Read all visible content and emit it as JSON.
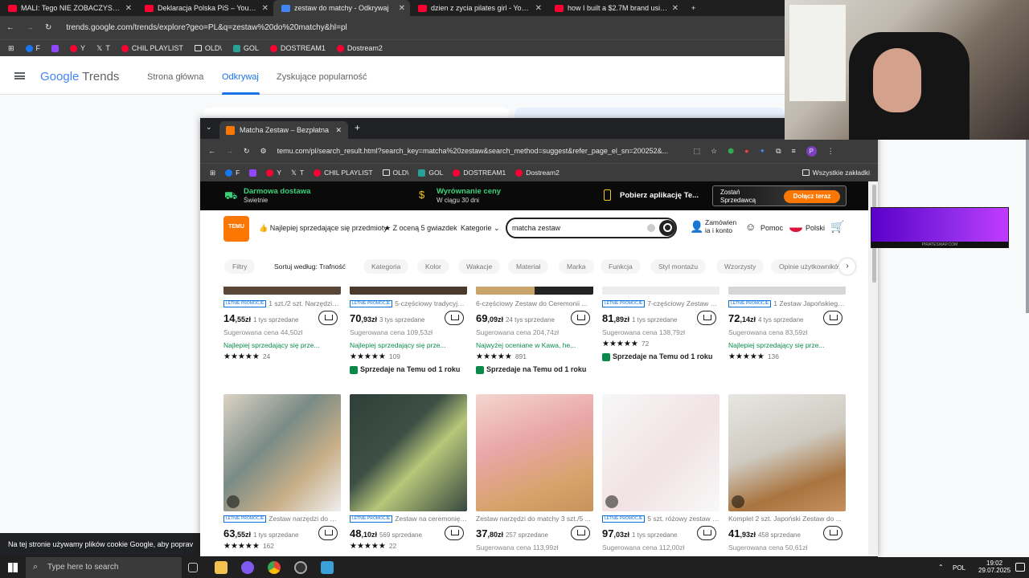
{
  "outer_tabs": [
    {
      "label": "MALI: Tego NIE ZOBACZYSZ w"
    },
    {
      "label": "Deklaracja Polska PiS – YouTube"
    },
    {
      "label": "zestaw do matchy - Odkrywaj"
    },
    {
      "label": "dzien z zycia pilates girl - YouTu"
    },
    {
      "label": "how I built a $2.7M brand using"
    }
  ],
  "outer_url": "trends.google.com/trends/explore?geo=PL&q=zestaw%20do%20matchy&hl=pl",
  "bookmarks": [
    "F",
    "Y",
    "T",
    "CHIL PLAYLIST",
    "OLD\\",
    "GOL",
    "DOSTREAM1",
    "Dostream2"
  ],
  "trends": {
    "logo_google": "Google",
    "logo_trends": "Trends",
    "nav": [
      "Strona główna",
      "Odkrywaj",
      "Zyskujące popularność"
    ],
    "cookie_text": "Na tej stronie używamy plików cookie Google, aby poprav"
  },
  "inner": {
    "tab_title": "Matcha Zestaw – Bezpłatna wy",
    "url": "temu.com/pl/search_result.html?search_key=matcha%20zestaw&search_method=suggest&refer_page_el_sn=200252&...",
    "bookmarks_right": "Wszystkie zakładki"
  },
  "promo": {
    "free_delivery": "Darmowa dostawa",
    "free_delivery_sub": "Świetnie",
    "price_adjust": "Wyrównanie ceny",
    "price_adjust_sub": "W ciągu 30 dni",
    "app": "Pobierz aplikację Te...",
    "seller_line1": "Zostań",
    "seller_line2": "Sprzedawcą",
    "join": "Dołącz teraz"
  },
  "temu_header": {
    "logo": "TEMU",
    "best_sellers": "Najlepiej sprzedające się przedmioty",
    "five_star": "Z oceną 5 gwiazdek",
    "categories": "Kategorie",
    "search_value": "matcha zestaw",
    "orders_line1": "Zamówien",
    "orders_line2": "ia i konto",
    "help": "Pomoc",
    "language": "Polski"
  },
  "filters": [
    "Filtry",
    "Sortuj według: Trafność",
    "Kategoria",
    "Kolor",
    "Wakacje",
    "Materiał",
    "Marka",
    "Funkcja",
    "Styl montażu",
    "Wzorzysty",
    "Opinie użytkowników"
  ],
  "badge_text": "LETNIE PROMOCJE",
  "row1": [
    {
      "title": "1 szt./2 szt. Narzędzia do ...",
      "price_int": "14",
      "price_dec": ",55zł",
      "sold": "1 tys sprzedane",
      "suggested": "Sugerowana cena 44,50zł",
      "tag": "Najlepiej sprzedający się prze...",
      "stars": "★★★★★",
      "reviews": "24",
      "since": ""
    },
    {
      "title": "5-częściowy tradycyjny jap...",
      "price_int": "70",
      "price_dec": ",93zł",
      "sold": "3 tys sprzedane",
      "suggested": "Sugerowana cena 109,53zł",
      "tag": "Najlepiej sprzedający się prze...",
      "stars": "★★★★★",
      "reviews": "109",
      "since": "Sprzedaje na Temu od 1 roku"
    },
    {
      "title": "6-częściowy Zestaw do Ceremonii ...",
      "price_int": "69",
      "price_dec": ",09zł",
      "sold": "24 tys sprzedane",
      "suggested": "Sugerowana cena 204,74zł",
      "tag": "Najwyżej oceniane w Kawa, he...",
      "stars": "★★★★★",
      "reviews": "891",
      "since": "Sprzedaje na Temu od 1 roku"
    },
    {
      "title": "7-częściowy Zestaw Do Ce...",
      "price_int": "81",
      "price_dec": ",89zł",
      "sold": "1 tys sprzedane",
      "suggested": "Sugerowana cena 138,79zł",
      "tag": "",
      "stars": "★★★★★",
      "reviews": "72",
      "since": "Sprzedaje na Temu od 1 roku"
    },
    {
      "title": "1 Zestaw Japońskiego Cera...",
      "price_int": "72",
      "price_dec": ",14zł",
      "sold": "4 tys sprzedane",
      "suggested": "Sugerowana cena 83,59zł",
      "tag": "Najlepiej sprzedający się prze...",
      "stars": "★★★★★",
      "reviews": "136",
      "since": ""
    }
  ],
  "row2": [
    {
      "title": "Zestaw narzędzi do match...",
      "price_int": "63",
      "price_dec": ",55zł",
      "sold": "1 tys sprzedane",
      "suggested": "",
      "stars": "★★★★★",
      "reviews": "162"
    },
    {
      "title": "Zestaw na ceremonię herb...",
      "price_int": "48",
      "price_dec": ",10zł",
      "sold": "569 sprzedane",
      "suggested": "",
      "stars": "★★★★★",
      "reviews": "22"
    },
    {
      "title": "Zestaw narzędzi do matchy 3 szt./5 ...",
      "price_int": "37",
      "price_dec": ",80zł",
      "sold": "257 sprzedane",
      "suggested": "Sugerowana cena 113,99zł",
      "stars": "",
      "reviews": ""
    },
    {
      "title": "5 szt. różowy zestaw do m...",
      "price_int": "97",
      "price_dec": ",03zł",
      "sold": "1 tys sprzedane",
      "suggested": "Sugerowana cena 112,00zł",
      "stars": "",
      "reviews": ""
    },
    {
      "title": "Komplet 2 szt. Japoński Zestaw do ...",
      "price_int": "41",
      "price_dec": ",93zł",
      "sold": "458 sprzedane",
      "suggested": "Sugerowana cena 50,61zł",
      "stars": "",
      "reviews": ""
    }
  ],
  "taskbar": {
    "search_placeholder": "Type here to search",
    "lang": "POL",
    "time": "19:02",
    "date": "29.07.2025"
  },
  "ad_text": "PIRATESWAP.COM",
  "colors": {
    "temu_orange": "#fb7701",
    "google_blue": "#1a73e8",
    "best_green": "#0a8a4a"
  }
}
